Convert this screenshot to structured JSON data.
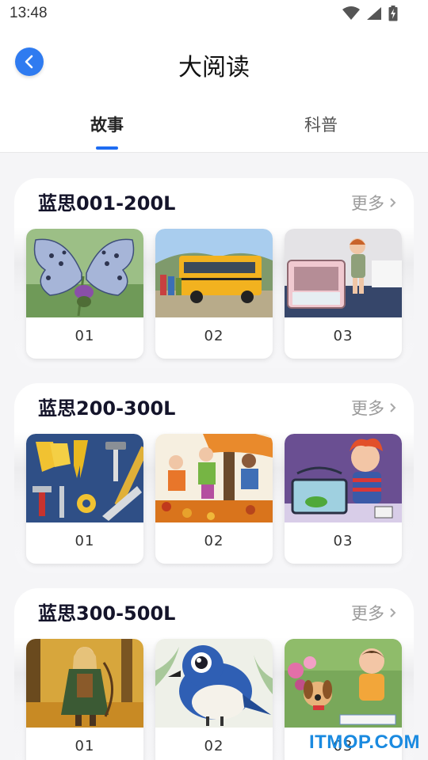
{
  "status_bar": {
    "time": "13:48"
  },
  "header": {
    "title": "大阅读"
  },
  "tabs": [
    {
      "label": "故事"
    },
    {
      "label": "科普"
    }
  ],
  "sections": [
    {
      "title": "蓝思001-200L",
      "more": "更多",
      "items": [
        {
          "label": "01"
        },
        {
          "label": "02"
        },
        {
          "label": "03"
        }
      ]
    },
    {
      "title": "蓝思200-300L",
      "more": "更多",
      "items": [
        {
          "label": "01"
        },
        {
          "label": "02"
        },
        {
          "label": "03"
        }
      ]
    },
    {
      "title": "蓝思300-500L",
      "more": "更多",
      "items": [
        {
          "label": "01"
        },
        {
          "label": "02"
        },
        {
          "label": "03"
        }
      ]
    }
  ],
  "watermark": "ITMOP.COM",
  "colors": {
    "accent": "#1e6cf2",
    "back_button": "#2f7bf0"
  },
  "icons": [
    "back-arrow-icon",
    "wifi-icon",
    "signal-icon",
    "battery-charging-icon",
    "chevron-right-icon"
  ]
}
